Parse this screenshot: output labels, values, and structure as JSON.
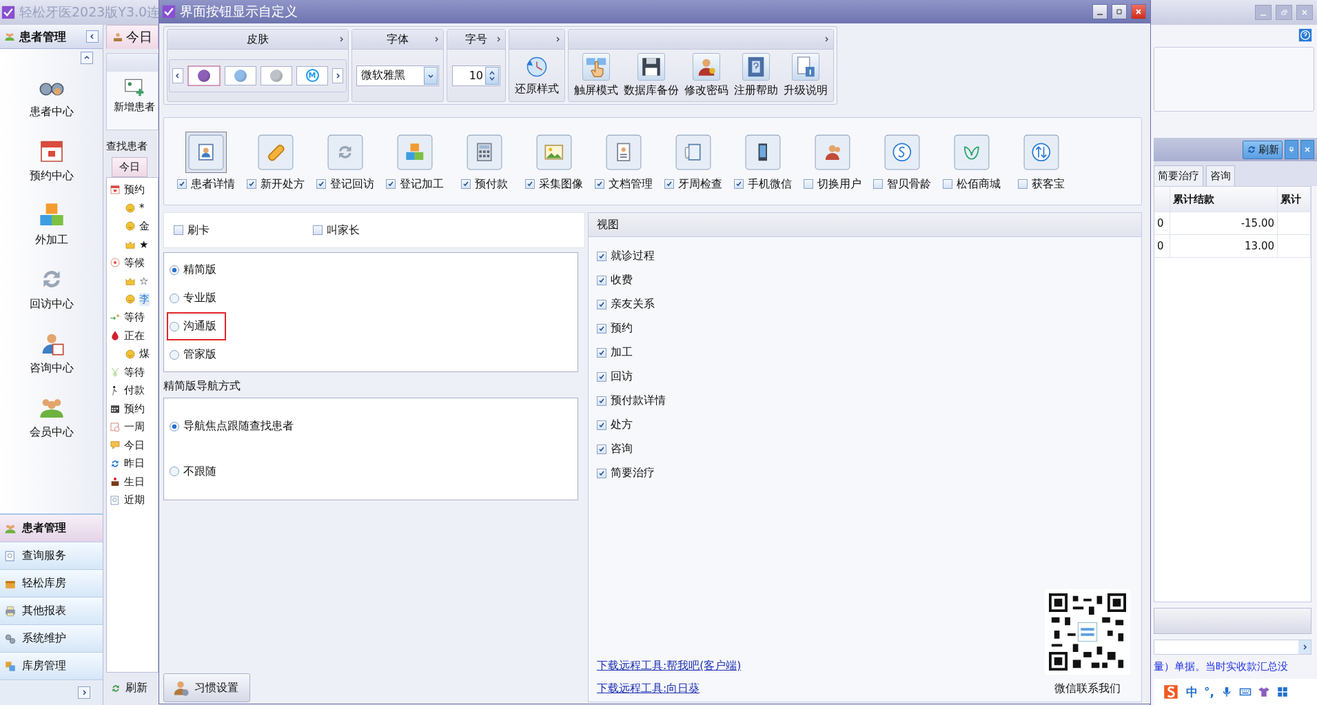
{
  "app": {
    "title": "轻松牙医2023版Y3.0连"
  },
  "sidebar": {
    "header": "患者管理",
    "nav": [
      {
        "label": "患者中心"
      },
      {
        "label": "预约中心"
      },
      {
        "label": "外加工"
      },
      {
        "label": "回访中心"
      },
      {
        "label": "咨询中心"
      },
      {
        "label": "会员中心"
      }
    ],
    "modules": [
      {
        "label": "患者管理",
        "selected": true
      },
      {
        "label": "查询服务",
        "selected": false
      },
      {
        "label": "轻松库房",
        "selected": false
      },
      {
        "label": "其他报表",
        "selected": false
      },
      {
        "label": "系统维护",
        "selected": false
      },
      {
        "label": "库房管理",
        "selected": false
      }
    ]
  },
  "middle": {
    "tab": "今日",
    "new_patient": "新增患者",
    "find_label": "查找患者",
    "list_tab": "今日",
    "refresh": "刷新",
    "tree": [
      {
        "label": "预约",
        "children": [
          {
            "label": "*",
            "selected": false
          },
          {
            "label": "金",
            "selected": false
          },
          {
            "label": "★",
            "selected": false
          }
        ]
      },
      {
        "label": "等候",
        "children": [
          {
            "label": "☆",
            "selected": false
          },
          {
            "label": "李",
            "selected": true
          }
        ]
      },
      {
        "label": "等待"
      },
      {
        "label": "正在",
        "children": [
          {
            "label": "煤",
            "selected": false
          }
        ]
      },
      {
        "label": "等待"
      },
      {
        "label": "付款"
      },
      {
        "label": "预约"
      },
      {
        "label": "一周"
      },
      {
        "label": "今日"
      },
      {
        "label": "昨日"
      },
      {
        "label": "生日"
      },
      {
        "label": "近期"
      }
    ]
  },
  "right": {
    "refresh": "刷新",
    "tabs": [
      {
        "label": "简要治疗",
        "selected": false
      },
      {
        "label": "咨询",
        "selected": false
      }
    ],
    "columns": [
      "累计结款",
      "累计"
    ],
    "rows": [
      [
        "0",
        "-15.00"
      ],
      [
        "0",
        "13.00"
      ]
    ],
    "status_text": "量）单据。当时实收款汇总没"
  },
  "ime": {
    "mode": "中",
    "punct": "°,"
  },
  "dialog": {
    "title": "界面按钮显示自定义",
    "ribbon": [
      {
        "kind": "skins",
        "title": "皮肤",
        "swatches": [
          {
            "color": "#8e5fb8",
            "selected": true
          },
          {
            "color": "#8fbbea",
            "selected": false
          },
          {
            "color": "#bcc2c8",
            "selected": false
          },
          {
            "color": "#1d9be8",
            "label": "M",
            "selected": false
          }
        ]
      },
      {
        "kind": "font",
        "title": "字体",
        "value": "微软雅黑"
      },
      {
        "kind": "size",
        "title": "字号",
        "value": "10"
      },
      {
        "kind": "buttons",
        "buttons": [
          {
            "label": "还原样式"
          }
        ]
      },
      {
        "kind": "buttons",
        "buttons": [
          {
            "label": "触屏模式"
          },
          {
            "label": "数据库备份"
          },
          {
            "label": "修改密码"
          },
          {
            "label": "注册帮助"
          },
          {
            "label": "升级说明"
          }
        ]
      }
    ],
    "features": [
      {
        "label": "患者详情",
        "checked": true,
        "selected": true
      },
      {
        "label": "新开处方",
        "checked": true,
        "selected": false
      },
      {
        "label": "登记回访",
        "checked": true,
        "selected": false
      },
      {
        "label": "登记加工",
        "checked": true,
        "selected": false
      },
      {
        "label": "预付款",
        "checked": true,
        "selected": false
      },
      {
        "label": "采集图像",
        "checked": true,
        "selected": false
      },
      {
        "label": "文档管理",
        "checked": true,
        "selected": false
      },
      {
        "label": "牙周检查",
        "checked": true,
        "selected": false
      },
      {
        "label": "手机微信",
        "checked": true,
        "selected": false
      },
      {
        "label": "切换用户",
        "checked": false,
        "selected": false
      },
      {
        "label": "智贝骨龄",
        "checked": false,
        "selected": false
      },
      {
        "label": "松佰商城",
        "checked": false,
        "selected": false
      },
      {
        "label": "获客宝",
        "checked": false,
        "selected": false
      }
    ],
    "options": [
      {
        "label": "刷卡",
        "checked": false
      },
      {
        "label": "叫家长",
        "checked": false
      }
    ],
    "editions": [
      {
        "label": "精简版",
        "selected": true,
        "highlighted": false
      },
      {
        "label": "专业版",
        "selected": false,
        "highlighted": false
      },
      {
        "label": "沟通版",
        "selected": false,
        "highlighted": true
      },
      {
        "label": "管家版",
        "selected": false,
        "highlighted": false
      }
    ],
    "nav_title": "精简版导航方式",
    "nav_modes": [
      {
        "label": "导航焦点跟随查找患者",
        "selected": true
      },
      {
        "label": "不跟随",
        "selected": false
      }
    ],
    "view": {
      "title": "视图",
      "items": [
        {
          "label": "就诊过程",
          "checked": true
        },
        {
          "label": "收费",
          "checked": true
        },
        {
          "label": "亲友关系",
          "checked": true
        },
        {
          "label": "预约",
          "checked": true
        },
        {
          "label": "加工",
          "checked": true
        },
        {
          "label": "回访",
          "checked": true
        },
        {
          "label": "预付款详情",
          "checked": true
        },
        {
          "label": "处方",
          "checked": true
        },
        {
          "label": "咨询",
          "checked": true
        },
        {
          "label": "简要治疗",
          "checked": true
        }
      ]
    },
    "links": [
      "下载远程工具:帮我吧(客户端)",
      "下载远程工具:向日葵"
    ],
    "qr_caption": "微信联系我们",
    "habit_button": "习惯设置"
  }
}
